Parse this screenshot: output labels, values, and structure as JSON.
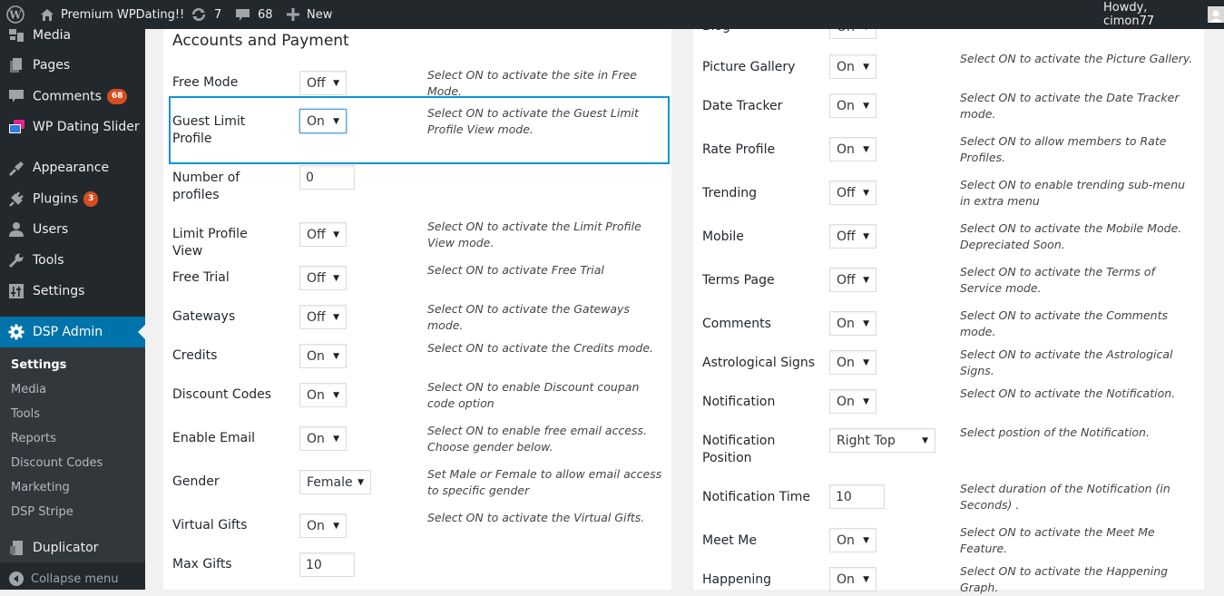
{
  "adminbar": {
    "site_name": "Premium WPDating!!",
    "updates_count": "7",
    "comments_count": "68",
    "new_label": "New",
    "howdy": "Howdy, cimon77"
  },
  "sidebar": {
    "items": [
      {
        "label": "Media",
        "icon": "media-icon"
      },
      {
        "label": "Pages",
        "icon": "pages-icon"
      },
      {
        "label": "Comments",
        "icon": "comments-icon",
        "badge": "68"
      },
      {
        "label": "WP Dating Slider",
        "icon": "slider-icon"
      },
      {
        "label": "Appearance",
        "icon": "appearance-icon"
      },
      {
        "label": "Plugins",
        "icon": "plugins-icon",
        "badge": "3"
      },
      {
        "label": "Users",
        "icon": "users-icon"
      },
      {
        "label": "Tools",
        "icon": "tools-icon"
      },
      {
        "label": "Settings",
        "icon": "settings-icon"
      },
      {
        "label": "DSP Admin",
        "icon": "gear-icon"
      },
      {
        "label": "Duplicator",
        "icon": "duplicator-icon"
      },
      {
        "label": "Collapse menu",
        "icon": "collapse-icon"
      }
    ],
    "submenu": [
      "Settings",
      "Media",
      "Tools",
      "Reports",
      "Discount Codes",
      "Marketing",
      "DSP Stripe"
    ]
  },
  "left_panel": {
    "title": "Accounts and Payment",
    "rows": [
      {
        "label": "Free Mode",
        "type": "select",
        "value": "Off",
        "desc": "Select ON to activate the site in Free Mode."
      },
      {
        "label": "Guest Limit Profile",
        "type": "select",
        "value": "On",
        "desc": "Select ON to activate the Guest Limit Profile View mode."
      },
      {
        "label": "Number of profiles",
        "type": "input",
        "value": "0",
        "desc": ""
      },
      {
        "label": "Limit Profile View",
        "type": "select",
        "value": "Off",
        "desc": "Select ON to activate the Limit Profile View mode."
      },
      {
        "label": "Free Trial",
        "type": "select",
        "value": "Off",
        "desc": "Select ON to activate Free Trial"
      },
      {
        "label": "Gateways",
        "type": "select",
        "value": "Off",
        "desc": "Select ON to activate the Gateways mode."
      },
      {
        "label": "Credits",
        "type": "select",
        "value": "On",
        "desc": "Select ON to activate the Credits mode."
      },
      {
        "label": "Discount Codes",
        "type": "select",
        "value": "On",
        "desc": " Select ON to enable Discount coupan code option"
      },
      {
        "label": "Enable Email",
        "type": "select",
        "value": "On",
        "desc": "Select ON to enable free email access. Choose gender below."
      },
      {
        "label": "Gender",
        "type": "select",
        "value": "Female",
        "desc": " Set Male or Female to allow email access to specific gender"
      },
      {
        "label": "Virtual Gifts",
        "type": "select",
        "value": "On",
        "desc": "Select ON to activate the Virtual Gifts."
      },
      {
        "label": "Max Gifts",
        "type": "input",
        "value": "10",
        "desc": ""
      }
    ]
  },
  "right_panel": {
    "rows": [
      {
        "label": "Blog",
        "type": "select",
        "value": "On",
        "desc": ""
      },
      {
        "label": "Picture Gallery",
        "type": "select",
        "value": "On",
        "desc": "Select ON to activate the Picture Gallery."
      },
      {
        "label": "Date Tracker",
        "type": "select",
        "value": "On",
        "desc": "Select ON to activate the Date Tracker mode."
      },
      {
        "label": "Rate Profile",
        "type": "select",
        "value": "On",
        "desc": " Select ON to allow members to Rate Profiles."
      },
      {
        "label": "Trending",
        "type": "select",
        "value": "Off",
        "desc": "Select ON to enable trending sub-menu in extra menu"
      },
      {
        "label": "Mobile",
        "type": "select",
        "value": "Off",
        "desc": "Select ON to activate the Mobile Mode. Depreciated Soon."
      },
      {
        "label": "Terms Page",
        "type": "select",
        "value": "Off",
        "desc": "Select ON to activate the Terms of Service mode."
      },
      {
        "label": "Comments",
        "type": "select",
        "value": "On",
        "desc": "Select ON to activate the Comments mode."
      },
      {
        "label": "Astrological Signs",
        "type": "select",
        "value": "On",
        "desc": "Select ON to activate the Astrological Signs."
      },
      {
        "label": "Notification",
        "type": "select",
        "value": "On",
        "desc": "Select ON to activate the Notification."
      },
      {
        "label": "Notification Position",
        "type": "select",
        "value": "Right Top",
        "desc": "Select postion of the Notification."
      },
      {
        "label": "Notification Time",
        "type": "input",
        "value": "10",
        "desc": "Select duration of the Notification (in Seconds) ."
      },
      {
        "label": "Meet Me",
        "type": "select",
        "value": "On",
        "desc": "Select ON to activate the Meet Me Feature."
      },
      {
        "label": "Happening",
        "type": "select",
        "value": "On",
        "desc": "Select ON to activate the Happening Graph."
      }
    ]
  }
}
